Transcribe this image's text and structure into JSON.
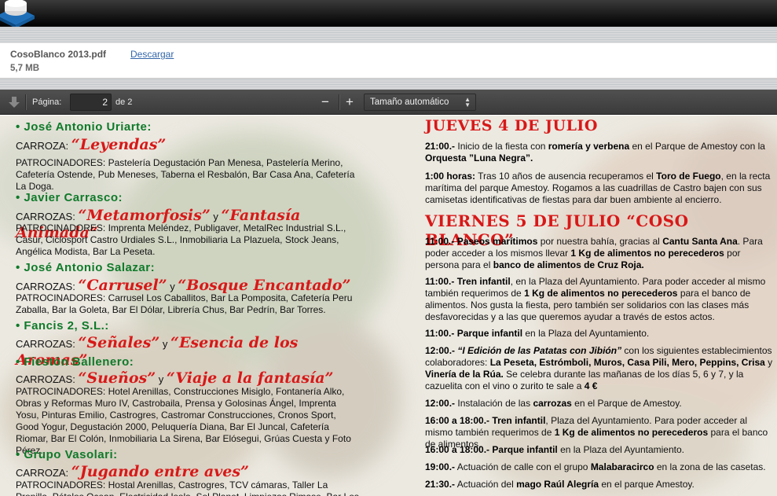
{
  "file": {
    "name": "CosoBlanco 2013.pdf",
    "download_label": "Descargar",
    "size": "5,7 MB"
  },
  "toolbar": {
    "page_label": "Página:",
    "page_value": "2",
    "page_total": "de 2",
    "zoom_out": "−",
    "zoom_in": "+",
    "zoom_value": "Tamaño automático"
  },
  "icons": {
    "app": "app-logo-icon",
    "download": "arrow-down-icon",
    "zoom_out": "minus-icon",
    "zoom_in": "plus-icon",
    "caret": "updown-caret-icon"
  },
  "colors": {
    "sponsor": "#0f7a2a",
    "float": "#d81818",
    "toolbar": "#474747"
  },
  "left": {
    "groups": [
      {
        "sponsor": "• José Antonio Uriarte:",
        "carroza_label": "CARROZA:",
        "floats": [
          "“Leyendas”"
        ],
        "sep": "",
        "patrocinadores": "PATROCINADORES: Pastelería Degustación Pan Menesa, Pastelería Merino, Cafetería Ostende, Pub Meneses, Taberna el Resbalón, Bar Casa Ana, Cafetería La Doga."
      },
      {
        "sponsor": "• Javier Carrasco:",
        "carroza_label": "CARROZAS:",
        "floats": [
          "“Metamorfosis”",
          "“Fantasía Animada”"
        ],
        "sep": "y",
        "patrocinadores": "PATROCINADORES: Imprenta Meléndez, Publigaver, MetalRec Industrial S.L., Casur, Ciclosport Castro Urdiales S.L., Inmobiliaria La Plazuela, Stock Jeans, Angélica Modista, Bar La Peseta."
      },
      {
        "sponsor": "• José Antonio Salazar:",
        "carroza_label": "CARROZAS:",
        "floats": [
          "“Carrusel”",
          "“Bosque Encantado”"
        ],
        "sep": "y",
        "patrocinadores": "PATROCINADORES: Carrusel Los Caballitos, Bar La Pomposita, Cafetería Peru Zaballa, Bar la Goleta, Bar El Dólar, Librería Chus, Bar Pedrín, Bar Torres."
      },
      {
        "sponsor": "• Fancis 2, S.L.:",
        "carroza_label": "CARROZAS:",
        "floats": [
          "“Señales”",
          "“Esencia de los Aromas”"
        ],
        "sep": "y",
        "patrocinadores": ""
      },
      {
        "sponsor": "• Fiestón Ballenero:",
        "carroza_label": "CARROZAS:",
        "floats": [
          "“Sueños”",
          "“Viaje a la fantasía”"
        ],
        "sep": "y",
        "patrocinadores": "PATROCINADORES: Hotel Arenillas, Construcciones Misiglo, Fontanería Alko, Obras y Reformas Muro IV, Castrobaila, Prensa y Golosinas Ángel, Imprenta Yosu, Pinturas Emilio, Castrogres, Castromar Construcciones, Cronos Sport, Good Yogur, Degustación 2000, Peluquería Diana, Bar El Juncal, Cafetería Riomar, Bar El Colón, Inmobiliaria La Sirena, Bar Elósegui, Grúas Cuesta y Foto Pérez."
      },
      {
        "sponsor": "• Grupo Vasolari:",
        "carroza_label": "CARROZA:",
        "floats": [
          "“Jugando entre aves”"
        ],
        "sep": "",
        "patrocinadores": "PATROCINADORES: Hostal Arenillas, Castrogres, TCV cámaras, Taller La Pronilla, Pétalos Ocean, Electricidad Isola, Sol Planet, Limpiezas Rimase, Bar Los Chelines."
      }
    ]
  },
  "right": {
    "day1": "JUEVES 4 DE JULIO",
    "day2": "VIERNES 5 DE JULIO “COSO BLANCO”",
    "e1_time": "21:00.-",
    "e1_a": " Inicio de la fiesta con ",
    "e1_b": "romería y verbena",
    "e1_c": " en el Parque de Amestoy con la ",
    "e1_d": "Orquesta ”Luna Negra”.",
    "e2_time": "1:00 horas:",
    "e2_a": " Tras 10 años de ausencia recuperamos el ",
    "e2_b": "Toro de Fuego",
    "e2_c": ", en la recta marítima del parque Amestoy. Rogamos a las cuadrillas de Castro bajen con sus camisetas identificativas de fiestas para dar buen ambiente al encierro.",
    "e3_time": "11:00.-",
    "e3_a": " Paseos marítimos",
    "e3_b": " por nuestra bahía, gracias al ",
    "e3_c": "Cantu Santa Ana",
    "e3_d": ". Para poder acceder a los mismos llevar ",
    "e3_e": "1 Kg de alimentos no perecederos",
    "e3_f": " por persona para el ",
    "e3_g": "banco de alimentos de Cruz Roja.",
    "e4_time": "11:00.-",
    "e4_a": " Tren infantil",
    "e4_b": ", en la Plaza del Ayuntamiento. Para poder acceder al mismo también requerimos de ",
    "e4_c": "1 Kg de alimentos no perecederos",
    "e4_d": " para el banco de alimentos. Nos gusta la fiesta, pero también ser solidarios con las clases más desfavorecidas y a las que queremos ayudar a través de estos actos.",
    "e5_time": "11:00.-",
    "e5_a": " Parque infantil",
    "e5_b": " en la Plaza del Ayuntamiento.",
    "e6_time": "12:00.-",
    "e6_a": " “I Edición de las Patatas con Jibión”",
    "e6_b": " con los siguientes establecimientos colaboradores: ",
    "e6_c": "La Peseta, Estrómboli, Muros, Casa Pili, Mero, Peppins, Crisa",
    "e6_d": " y ",
    "e6_e": "Vinería de la Rúa.",
    "e6_f": " Se celebra durante las mañanas de los días 5, 6 y 7, y la cazuelita con el vino o zurito te sale a ",
    "e6_g": "4 €",
    "e7_time": "12:00.-",
    "e7_a": " Instalación de las ",
    "e7_b": "carrozas",
    "e7_c": " en el Parque de Amestoy.",
    "e8_time": "16:00 a 18:00.-",
    "e8_a": " Tren infantil",
    "e8_b": ", Plaza del Ayuntamiento. Para poder acceder al mismo también requerimos de ",
    "e8_c": "1 Kg de alimentos no perecederos",
    "e8_d": " para el banco de alimentos.",
    "e9_time": "16:00 a 18:00.-",
    "e9_a": " Parque infantil",
    "e9_b": " en la Plaza del Ayuntamiento.",
    "e10_time": "19:00.-",
    "e10_a": " Actuación de calle con el grupo ",
    "e10_b": "Malabaracirco",
    "e10_c": " en la zona de las casetas.",
    "e11_time": "21:30.-",
    "e11_a": " Actuación del ",
    "e11_b": "mago Raúl Alegría",
    "e11_c": " en el parque Amestoy."
  }
}
